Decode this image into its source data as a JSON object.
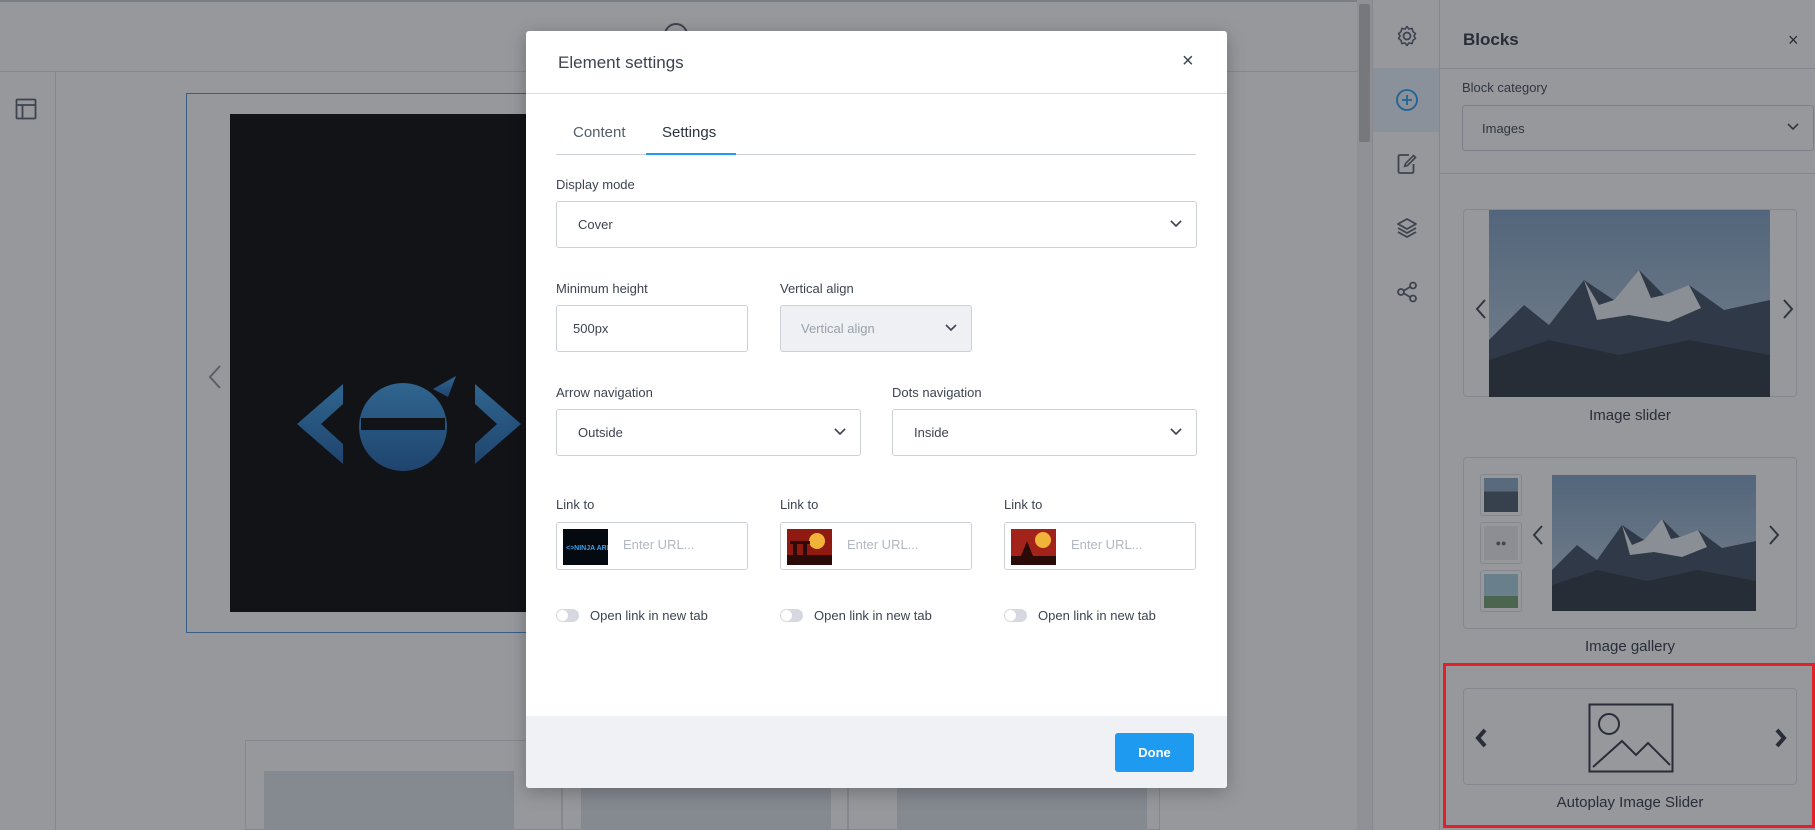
{
  "panel": {
    "title": "Blocks",
    "close": "×",
    "category_label": "Block category",
    "category_value": "Images",
    "blocks": [
      {
        "label": "Image slider"
      },
      {
        "label": "Image gallery"
      },
      {
        "label": "Autoplay Image Slider"
      }
    ]
  },
  "modal": {
    "title": "Element settings",
    "close": "×",
    "tabs": [
      {
        "label": "Content"
      },
      {
        "label": "Settings"
      }
    ],
    "active_tab": "Settings",
    "display_mode": {
      "label": "Display mode",
      "value": "Cover"
    },
    "min_height": {
      "label": "Minimum height",
      "value": "500px"
    },
    "vertical_align": {
      "label": "Vertical align",
      "placeholder": "Vertical align"
    },
    "arrow_nav": {
      "label": "Arrow navigation",
      "value": "Outside"
    },
    "dots_nav": {
      "label": "Dots navigation",
      "value": "Inside"
    },
    "links": [
      {
        "label": "Link to",
        "placeholder": "Enter URL...",
        "toggle_label": "Open link in new tab",
        "new_tab": false
      },
      {
        "label": "Link to",
        "placeholder": "Enter URL...",
        "toggle_label": "Open link in new tab",
        "new_tab": false
      },
      {
        "label": "Link to",
        "placeholder": "Enter URL...",
        "toggle_label": "Open link in new tab",
        "new_tab": false
      }
    ],
    "done": "Done"
  },
  "icons": {
    "rail": [
      "gear-icon",
      "add-circle-icon",
      "edit-icon",
      "layers-icon",
      "share-icon"
    ],
    "editor_left": "layout-icon"
  },
  "colors": {
    "accent": "#1e9af0",
    "highlight": "#e3212b",
    "overlay": "rgba(36,40,48,0.48)"
  }
}
